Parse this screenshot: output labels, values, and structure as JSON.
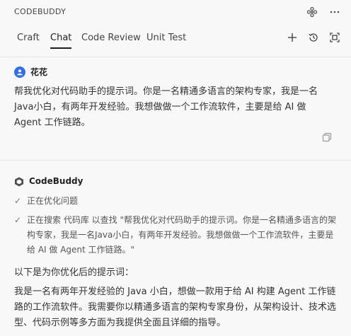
{
  "app": {
    "title": "CODEBUDDY"
  },
  "tabs": [
    {
      "label": "Craft",
      "active": false
    },
    {
      "label": "Chat",
      "active": true
    },
    {
      "label": "Code Review",
      "active": false
    },
    {
      "label": "Unit Test",
      "active": false
    }
  ],
  "icons": {
    "top": [
      "plugin-icon",
      "more-icon"
    ],
    "actions": [
      "new-chat-icon",
      "history-icon",
      "fullscreen-icon"
    ],
    "copy": "copy-icon",
    "user_avatar": "user-avatar-icon",
    "bot_logo": "codebuddy-logo-icon",
    "check": "✓"
  },
  "user_message": {
    "name": "花花",
    "text": "帮我优化对代码助手的提示词。你是一名精通多语言的架构专家，我是一名Java小白，有两年开发经验。我想做做一个工作流软件，主要是给 AI 做 Agent 工作链路。"
  },
  "bot_message": {
    "name": "CodeBuddy",
    "steps": [
      "正在优化问题",
      "正在搜索 代码库 以查找 \"帮我优化对代码助手的提示词。你是一名精通多语言的架构专家，我是一名Java小白，有两年开发经验。我想做做一个工作流软件，主要是给 AI 做 Agent 工作链路。\""
    ],
    "intro": "以下是为你优化后的提示词：",
    "prompt": "我是一名有两年开发经验的 Java 小白，想做一款用于给 AI 构建 Agent 工作链路的工作流软件。我需要你以精通多语言的架构专家身份，从架构设计、技术选型、代码示例等多方面为我提供全面且详细的指导。"
  },
  "colors": {
    "background": "#f8f8f8",
    "avatar": "#2f6fed",
    "divider": "#e6e6e6"
  }
}
